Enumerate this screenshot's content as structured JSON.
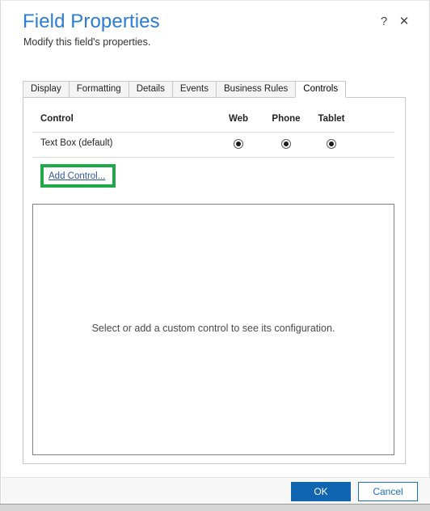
{
  "window": {
    "title": "Field Properties",
    "subtitle": "Modify this field's properties.",
    "help_icon": "question-mark-icon",
    "close_icon": "close-icon",
    "help_glyph": "?",
    "close_glyph": "✕"
  },
  "tabs": [
    {
      "label": "Display",
      "active": false
    },
    {
      "label": "Formatting",
      "active": false
    },
    {
      "label": "Details",
      "active": false
    },
    {
      "label": "Events",
      "active": false
    },
    {
      "label": "Business Rules",
      "active": false
    },
    {
      "label": "Controls",
      "active": true
    }
  ],
  "controls_tab": {
    "table": {
      "columns": [
        "Control",
        "Web",
        "Phone",
        "Tablet"
      ],
      "rows": [
        {
          "control": "Text Box (default)",
          "web": true,
          "phone": true,
          "tablet": true
        }
      ]
    },
    "add_control_link": "Add Control...",
    "configuration_empty_text": "Select or add a custom control to see its configuration."
  },
  "footer": {
    "ok_label": "OK",
    "cancel_label": "Cancel"
  },
  "colors": {
    "title_blue": "#2b7cd3",
    "link_blue": "#2b5797",
    "ok_button_blue": "#1064b0",
    "cancel_text_blue": "#1c6fc4",
    "highlight_green": "#21a84a",
    "tab_inactive_bg": "#f4f4f4",
    "border_gray": "#c8c8c8",
    "footer_bg": "#f7f7f7"
  }
}
